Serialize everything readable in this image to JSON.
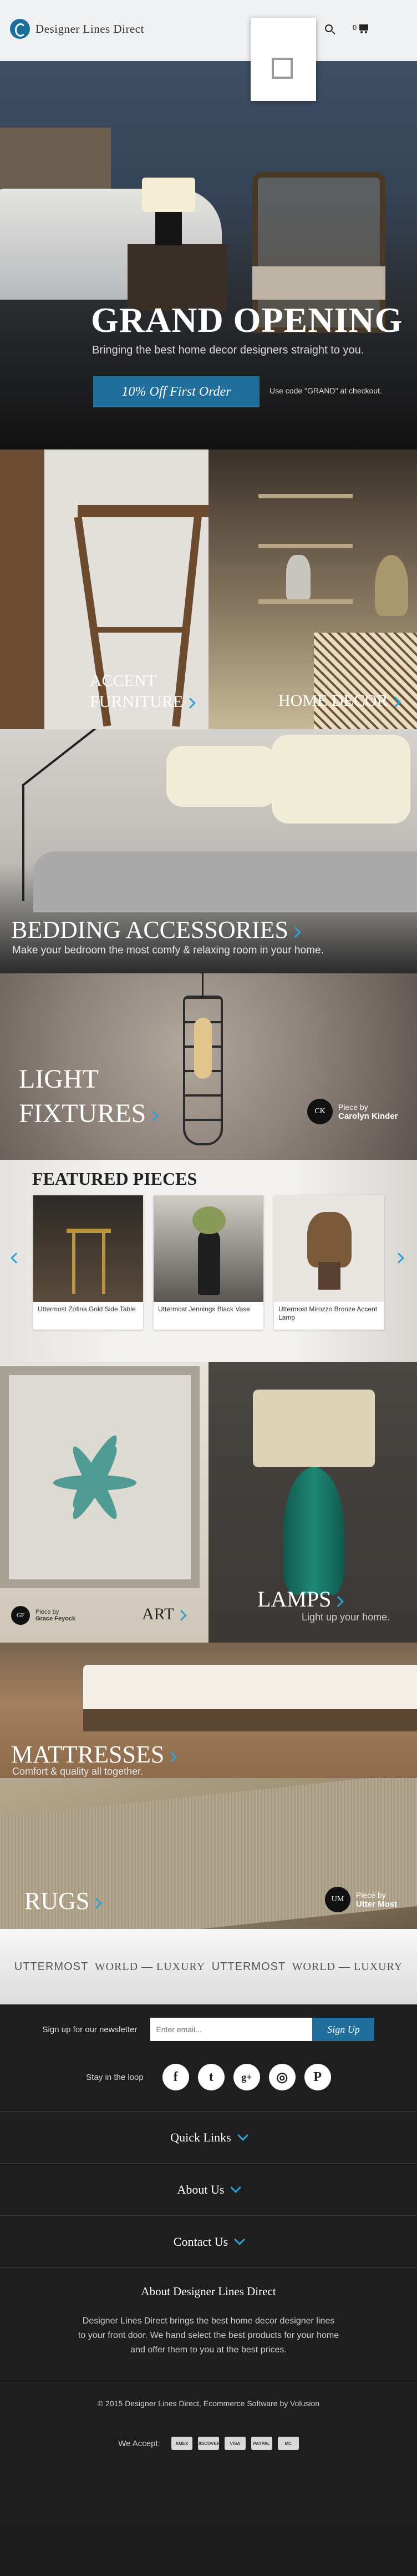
{
  "header": {
    "logo_text": "Designer Lines Direct",
    "cart_count": "0",
    "icons": [
      "search-icon",
      "cart-icon"
    ]
  },
  "hero": {
    "title": "GRAND OPENING",
    "subtitle": "Bringing the best home decor designers straight to you.",
    "cta_label": "10% Off First Order",
    "cta_note": "Use code \"GRAND\" at checkout."
  },
  "categories": {
    "accent_furniture": [
      "ACCENT",
      "FURNITURE"
    ],
    "home_decor": "HOME DECOR",
    "bedding": {
      "title": "BEDDING ACCESSORIES",
      "subtitle": "Make your bedroom the most comfy & relaxing room in your home."
    },
    "light_fixtures": [
      "LIGHT",
      "FIXTURES"
    ],
    "light_credit": {
      "badge": "CK",
      "line1": "Piece by",
      "line2": "Carolyn Kinder"
    },
    "art": "ART",
    "art_credit": {
      "badge": "GF",
      "line1": "Piece by",
      "line2": "Grace Feyock"
    },
    "lamps": {
      "title": "LAMPS",
      "subtitle": "Light up your home."
    },
    "mattresses": {
      "title": "MATTRESSES",
      "subtitle": "Comfort & quality all together."
    },
    "rugs": "RUGS",
    "rugs_credit": {
      "badge": "UM",
      "line1": "Piece by",
      "line2": "Utter Most"
    }
  },
  "featured": {
    "title": "FEATURED PIECES",
    "items": [
      {
        "name": "Uttermost Zofina Gold Side Table"
      },
      {
        "name": "Uttermost Jennings Black Vase"
      },
      {
        "name": "Uttermost Mirozzo Bronze Accent Lamp"
      }
    ]
  },
  "brands": [
    "UTTERMOST",
    "WORLD — LUXURY",
    "UTTERMOST",
    "WORLD — LUXURY"
  ],
  "footer": {
    "newsletter_label": "Sign up for our newsletter",
    "email_placeholder": "Enter email...",
    "signup_label": "Sign Up",
    "social_label": "Stay in the loop",
    "social_icons": [
      {
        "name": "facebook-icon",
        "glyph": "f"
      },
      {
        "name": "twitter-icon",
        "glyph": "t"
      },
      {
        "name": "google-plus-icon",
        "glyph": "g+"
      },
      {
        "name": "instagram-icon",
        "glyph": "◎"
      },
      {
        "name": "pinterest-icon",
        "glyph": "P"
      }
    ],
    "accordions": [
      "Quick Links",
      "About Us",
      "Contact Us"
    ],
    "about_title": "About Designer Lines Direct",
    "about_text": "Designer Lines Direct brings the  best home decor designer lines to your front door. We hand select the best products for your home and offer them to you at the best prices.",
    "copyright": "© 2015 Designer Lines Direct, Ecommerce Software by Volusion",
    "pay_label": "We Accept:",
    "payment_cards": [
      "AMEX",
      "DISCOVER",
      "VISA",
      "PAYPAL",
      "MC"
    ]
  },
  "colors": {
    "accent": "#1f6e9b",
    "arrow": "#2ea2d4",
    "footer_bg": "#1e1e1e"
  }
}
